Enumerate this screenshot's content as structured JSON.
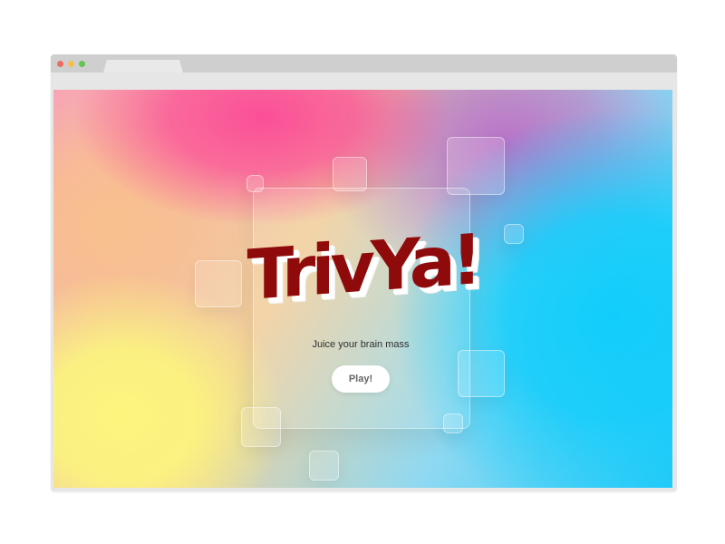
{
  "window": {
    "controls": [
      "close",
      "minimize",
      "maximize"
    ],
    "control_colors": {
      "close": "#ef6b5e",
      "minimize": "#f4bf4f",
      "maximize": "#61c554"
    }
  },
  "app": {
    "logo_text": "TrivYa!",
    "tagline": "Juice your brain mass",
    "play_label": "Play!"
  },
  "colors": {
    "gradient_yellow": "#fbf57e",
    "gradient_pink": "#fb4f97",
    "gradient_blue": "#12cdfb",
    "logo_red": "#8f0b0b"
  }
}
